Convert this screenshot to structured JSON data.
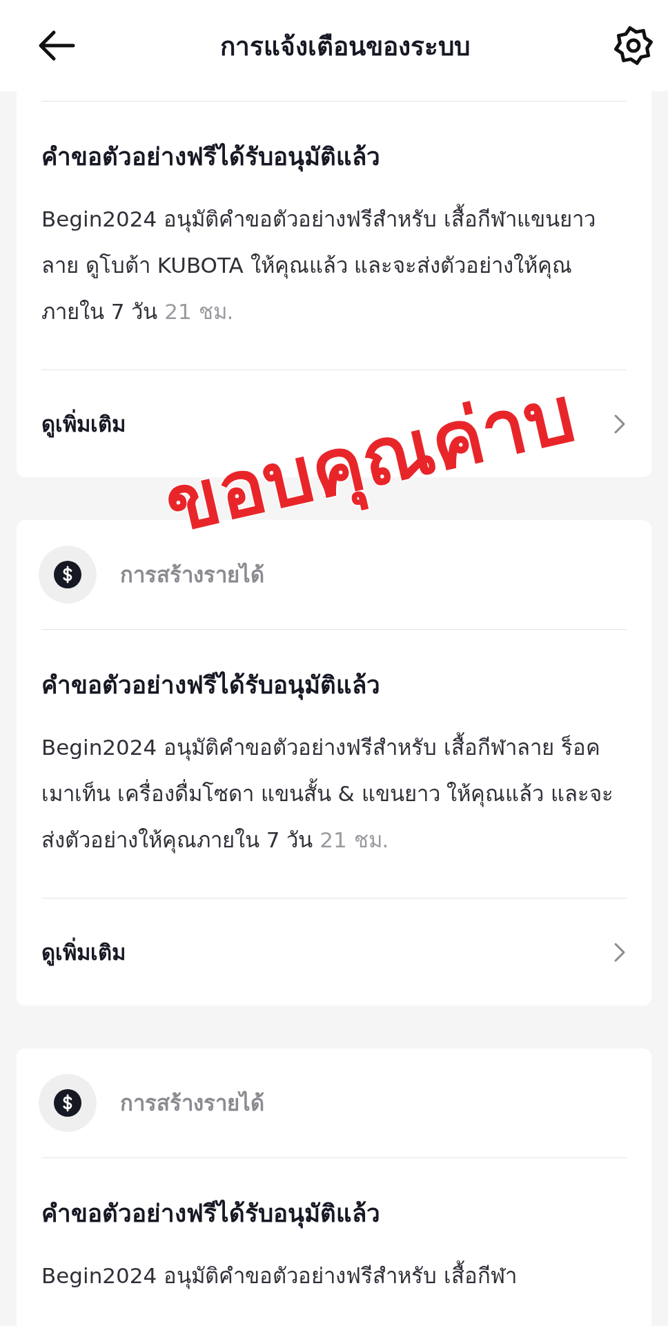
{
  "header": {
    "title": "การแจ้งเตือนของระบบ"
  },
  "notifications": [
    {
      "title": "คำขอตัวอย่างฟรีได้รับอนุมัติแล้ว",
      "body": "Begin2024 อนุมัติคำขอตัวอย่างฟรีสำหรับ เสื้อกีฬาแขนยาว ลาย ดูโบต้า KUBOTA ให้คุณแล้ว และจะส่งตัวอย่างให้คุณภายใน 7 วัน",
      "time": "21 ชม.",
      "link": "ดูเพิ่มเติม"
    },
    {
      "category": "การสร้างรายได้",
      "title": "คำขอตัวอย่างฟรีได้รับอนุมัติแล้ว",
      "body": "Begin2024 อนุมัติคำขอตัวอย่างฟรีสำหรับ เสื้อกีฬาลาย ร็อคเมาเท็น เครื่องดื่มโซดา แขนสั้น & แขนยาว ให้คุณแล้ว และจะส่งตัวอย่างให้คุณภายใน 7 วัน",
      "time": "21 ชม.",
      "link": "ดูเพิ่มเติม"
    },
    {
      "category": "การสร้างรายได้",
      "title": "คำขอตัวอย่างฟรีได้รับอนุมัติแล้ว",
      "body": "Begin2024 อนุมัติคำขอตัวอย่างฟรีสำหรับ เสื้อกีฬา"
    }
  ],
  "overlay_text": "ขอบคุณค่าบ"
}
